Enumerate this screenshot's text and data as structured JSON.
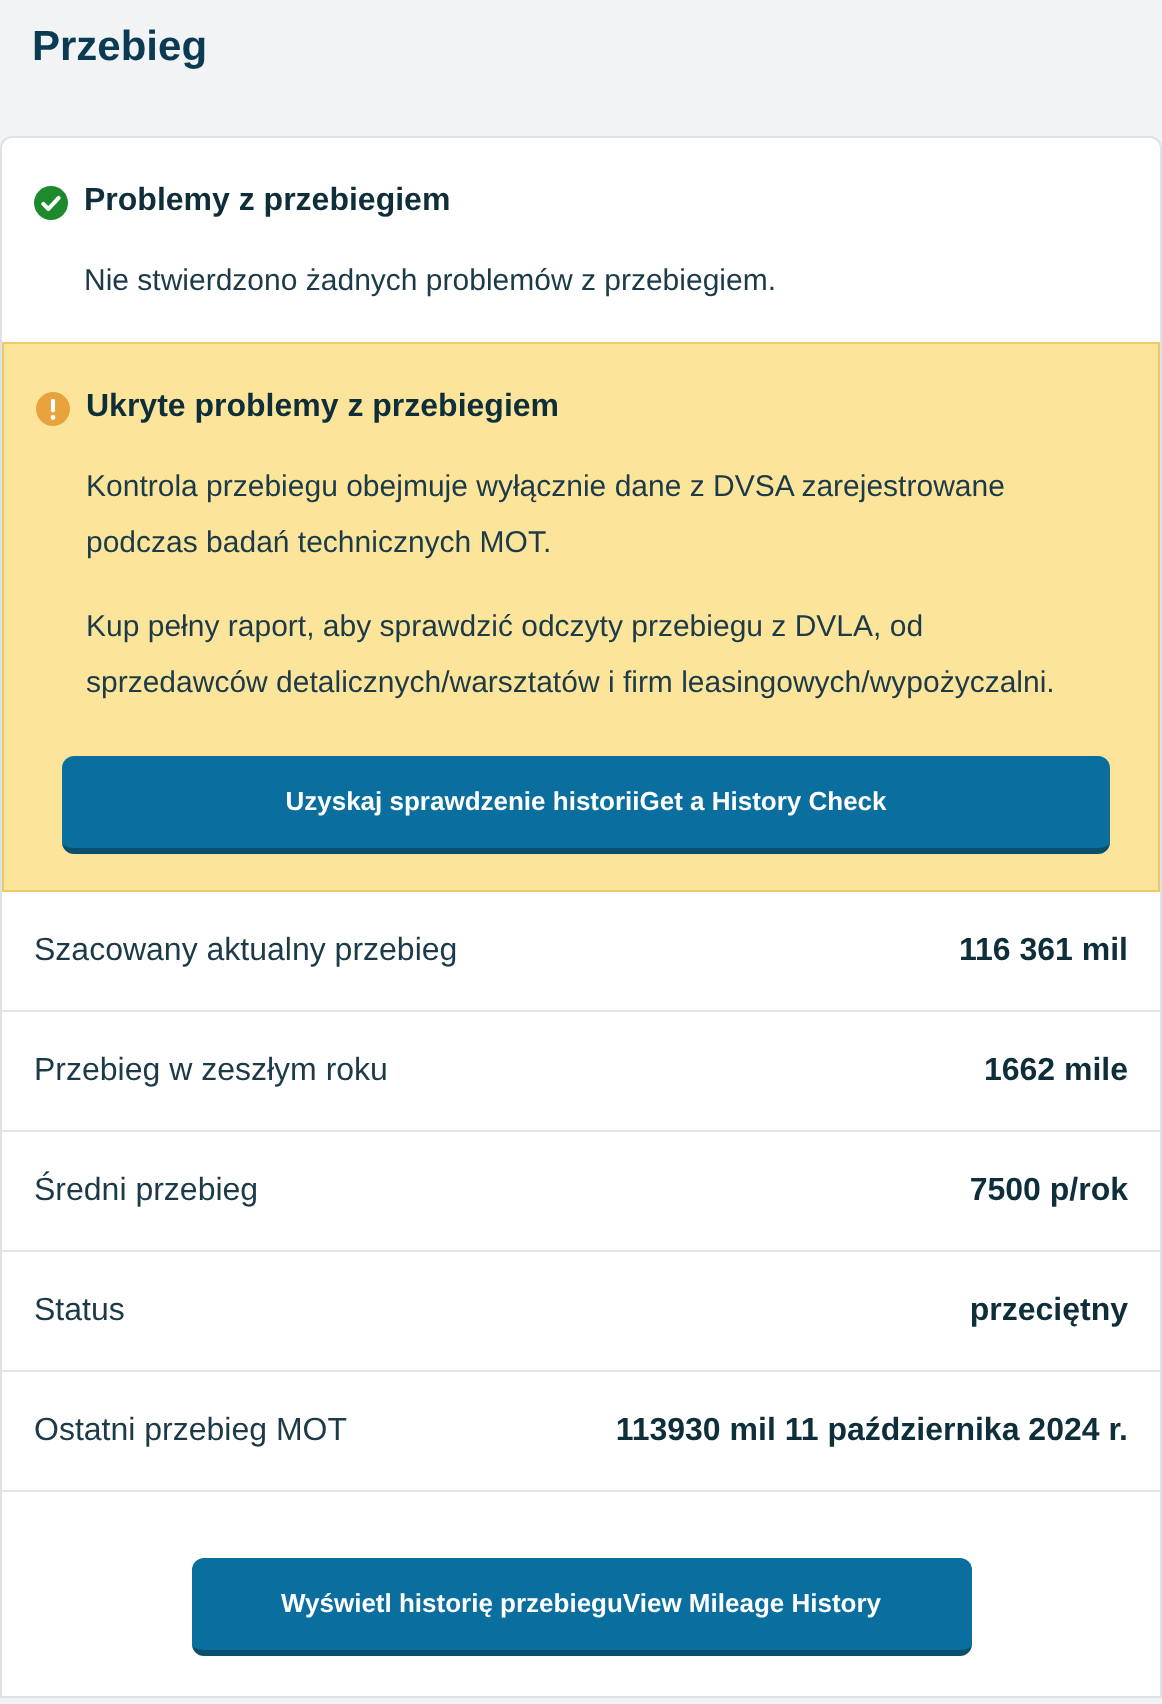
{
  "title": "Przebieg",
  "alerts": [
    {
      "kind": "success",
      "heading": "Problemy z przebiegiem",
      "paragraphs": [
        "Nie stwierdzono żadnych problemów z przebiegiem."
      ]
    },
    {
      "kind": "warning",
      "heading": "Ukryte problemy z przebiegiem",
      "paragraphs": [
        "Kontrola przebiegu obejmuje wyłącznie dane z DVSA zarejestrowane podczas badań technicznych MOT.",
        "Kup pełny raport, aby sprawdzić odczyty przebiegu z DVLA, od sprzedawców detalicznych/warsztatów i firm leasingowych/wypożyczalni."
      ],
      "button": "Uzyskaj sprawdzenie historiiGet a History Check"
    }
  ],
  "rows": [
    {
      "label": "Szacowany aktualny przebieg",
      "value": "116 361 mil"
    },
    {
      "label": "Przebieg w zeszłym roku",
      "value": "1662 mile"
    },
    {
      "label": "Średni przebieg",
      "value": "7500 p/rok"
    },
    {
      "label": "Status",
      "value": "przeciętny"
    },
    {
      "label": "Ostatni przebieg MOT",
      "value": "113930 mil 11 października 2024 r."
    }
  ],
  "history_button": "Wyświetl historię przebieguView Mileage History"
}
